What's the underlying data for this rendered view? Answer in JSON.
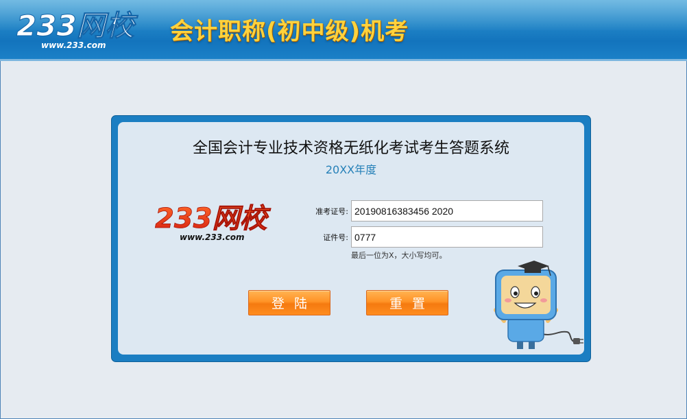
{
  "header": {
    "logo_text": "233网校",
    "logo_url": "www.233.com",
    "title": "会计职称(初中级)机考"
  },
  "panel": {
    "system_title": "全国会计专业技术资格无纸化考试考生答题系统",
    "year": "20XX年度",
    "logo_text": "233网校",
    "logo_url": "www.233.com",
    "form": {
      "admission_label": "准考证号:",
      "admission_value": "20190816383456 2020",
      "id_label": "证件号:",
      "id_value": "0777",
      "hint": "最后一位为X，大小写均可。"
    },
    "buttons": {
      "login": "登陆",
      "reset": "重置"
    }
  },
  "colors": {
    "header_blue": "#1f83c6",
    "title_yellow": "#ffd23c",
    "panel_blue": "#1b7ec2",
    "button_orange": "#ff9326",
    "logo_red": "#e8331c"
  }
}
